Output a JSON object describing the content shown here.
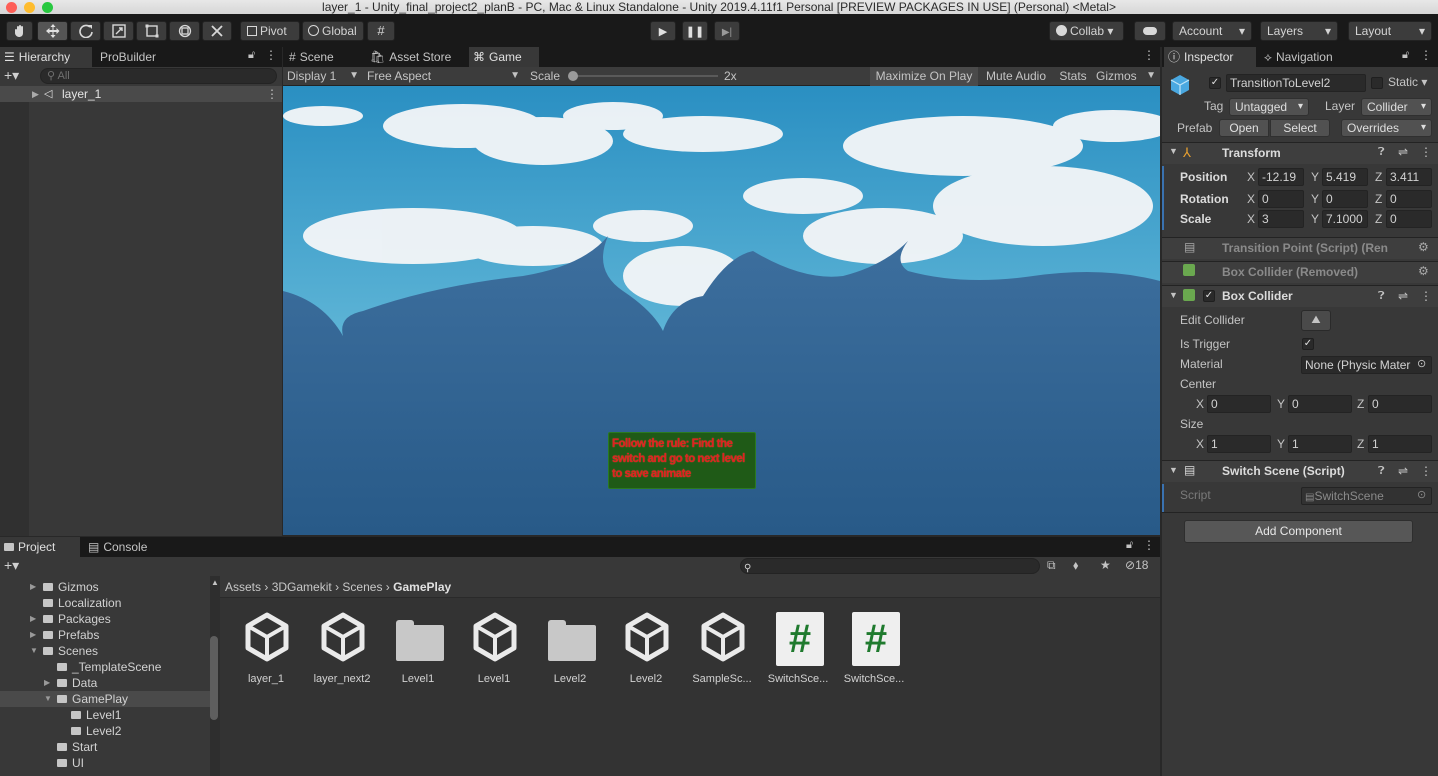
{
  "window_title": "layer_1 - Unity_final_project2_planB - PC, Mac & Linux Standalone - Unity 2019.4.11f1 Personal [PREVIEW PACKAGES IN USE] (Personal) <Metal>",
  "toolbar": {
    "pivot": "Pivot",
    "global": "Global",
    "collab": "Collab",
    "account": "Account",
    "layers": "Layers",
    "layout": "Layout"
  },
  "hierarchy": {
    "tab": "Hierarchy",
    "tab2": "ProBuilder",
    "search_placeholder": "All",
    "root_item": "layer_1"
  },
  "game_view": {
    "tabs": [
      "Scene",
      "Asset Store",
      "Game"
    ],
    "display": "Display 1",
    "aspect": "Free Aspect",
    "scale_label": "Scale",
    "scale_value": "2x",
    "maximize": "Maximize On Play",
    "mute": "Mute Audio",
    "stats": "Stats",
    "gizmos": "Gizmos",
    "sign_text": "Follow the rule: Find the switch and go to next level to save animate"
  },
  "inspector": {
    "tab": "Inspector",
    "tab2": "Navigation",
    "object_name": "TransitionToLevel2",
    "static_label": "Static",
    "tag_label": "Tag",
    "tag_value": "Untagged",
    "layer_label": "Layer",
    "layer_value": "Collider",
    "prefab_label": "Prefab",
    "prefab_open": "Open",
    "prefab_select": "Select",
    "prefab_overrides": "Overrides",
    "transform": {
      "title": "Transform",
      "position_label": "Position",
      "rotation_label": "Rotation",
      "scale_label": "Scale",
      "position": {
        "x": "-12.19",
        "y": "5.419",
        "z": "3.411"
      },
      "rotation": {
        "x": "0",
        "y": "0",
        "z": "0"
      },
      "scale": {
        "x": "3",
        "y": "7.1000",
        "z": "0"
      }
    },
    "removed_script": "Transition Point (Script) (Ren",
    "removed_collider": "Box Collider (Removed)",
    "box_collider": {
      "title": "Box Collider",
      "edit_collider": "Edit Collider",
      "is_trigger": "Is Trigger",
      "material_label": "Material",
      "material_value": "None (Physic Mater",
      "center_label": "Center",
      "center": {
        "x": "0",
        "y": "0",
        "z": "0"
      },
      "size_label": "Size",
      "size": {
        "x": "1",
        "y": "1",
        "z": "1"
      }
    },
    "switch_scene": {
      "title": "Switch Scene (Script)",
      "script_label": "Script",
      "script_value": "SwitchScene"
    },
    "add_component": "Add Component"
  },
  "project": {
    "tab": "Project",
    "tab2": "Console",
    "hidden_count": "18",
    "breadcrumb": [
      "Assets",
      "3DGamekit",
      "Scenes",
      "GamePlay"
    ],
    "tree": [
      {
        "label": "Gizmos",
        "indent": 0
      },
      {
        "label": "Localization",
        "indent": 0
      },
      {
        "label": "Packages",
        "indent": 0
      },
      {
        "label": "Prefabs",
        "indent": 0
      },
      {
        "label": "Scenes",
        "indent": 0
      },
      {
        "label": "_TemplateScene",
        "indent": 1
      },
      {
        "label": "Data",
        "indent": 1
      },
      {
        "label": "GamePlay",
        "indent": 1
      },
      {
        "label": "Level1",
        "indent": 2
      },
      {
        "label": "Level2",
        "indent": 2
      },
      {
        "label": "Start",
        "indent": 1
      },
      {
        "label": "UI",
        "indent": 1
      }
    ],
    "assets": [
      {
        "label": "layer_1",
        "kind": "unity"
      },
      {
        "label": "layer_next2",
        "kind": "unity"
      },
      {
        "label": "Level1",
        "kind": "folder"
      },
      {
        "label": "Level1",
        "kind": "unity"
      },
      {
        "label": "Level2",
        "kind": "folder"
      },
      {
        "label": "Level2",
        "kind": "unity"
      },
      {
        "label": "SampleSc...",
        "kind": "unity"
      },
      {
        "label": "SwitchSce...",
        "kind": "script"
      },
      {
        "label": "SwitchSce...",
        "kind": "script"
      }
    ]
  },
  "colors": {
    "accent": "#3a72b0",
    "sign_bg": "#1f5a17",
    "sign_text": "#e02020",
    "script_hash": "#1f7a2e"
  }
}
